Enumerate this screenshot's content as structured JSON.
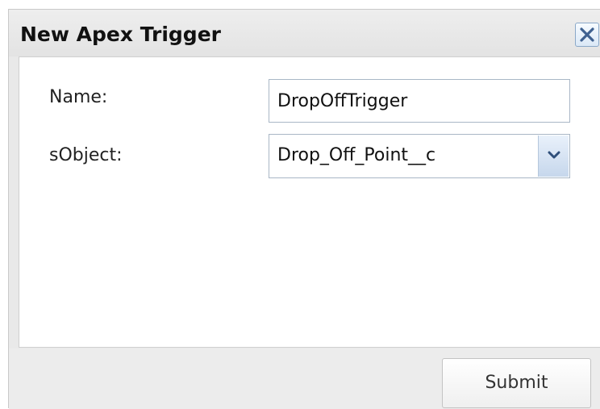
{
  "dialog": {
    "title": "New Apex Trigger",
    "close_icon": "close-icon"
  },
  "form": {
    "name_label": "Name:",
    "name_value": "DropOffTrigger",
    "sobject_label": "sObject:",
    "sobject_value": "Drop_Off_Point__c",
    "dropdown_icon": "chevron-down-icon"
  },
  "footer": {
    "submit_label": "Submit"
  },
  "colors": {
    "accent_blue": "#4a6e9a",
    "panel_bg": "#e9e9e9",
    "content_bg": "#ffffff"
  }
}
